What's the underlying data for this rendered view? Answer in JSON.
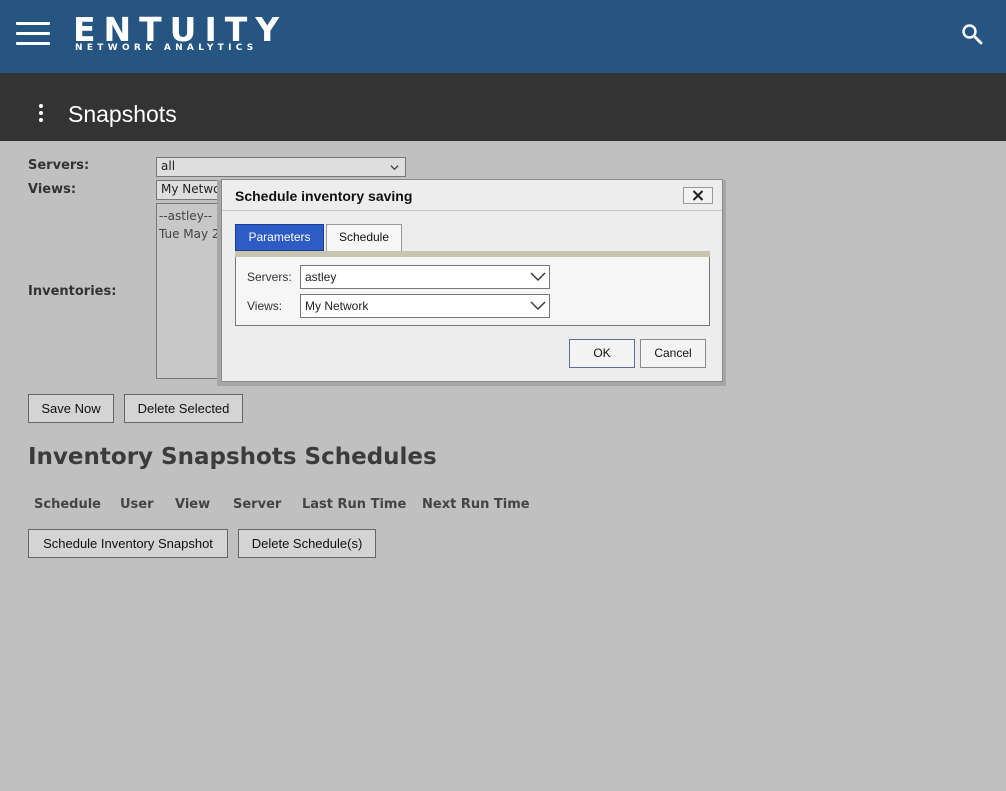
{
  "header": {
    "logo_main": "ENTUITY",
    "logo_sub": "NETWORK ANALYTICS",
    "brand_color": "#255580"
  },
  "titlebar": {
    "title": "Snapshots"
  },
  "form": {
    "servers_label": "Servers:",
    "servers_value": "all",
    "views_label": "Views:",
    "views_value": "My Network",
    "inventories_label": "Inventories:",
    "inventory_items": [
      "--astley--",
      "Tue May 2"
    ]
  },
  "buttons": {
    "save_now": "Save Now",
    "delete_selected": "Delete Selected",
    "schedule_snapshot": "Schedule Inventory Snapshot",
    "delete_schedules": "Delete Schedule(s)"
  },
  "schedules": {
    "title": "Inventory Snapshots Schedules",
    "columns": [
      "Schedule",
      "User",
      "View",
      "Server",
      "Last Run Time",
      "Next Run Time"
    ]
  },
  "dialog": {
    "title": "Schedule inventory saving",
    "tabs": [
      "Parameters",
      "Schedule"
    ],
    "active_tab": "Parameters",
    "servers_label": "Servers:",
    "servers_value": "astley",
    "views_label": "Views:",
    "views_value": "My Network",
    "ok_label": "OK",
    "cancel_label": "Cancel",
    "accent_color": "#2e5cc6"
  }
}
